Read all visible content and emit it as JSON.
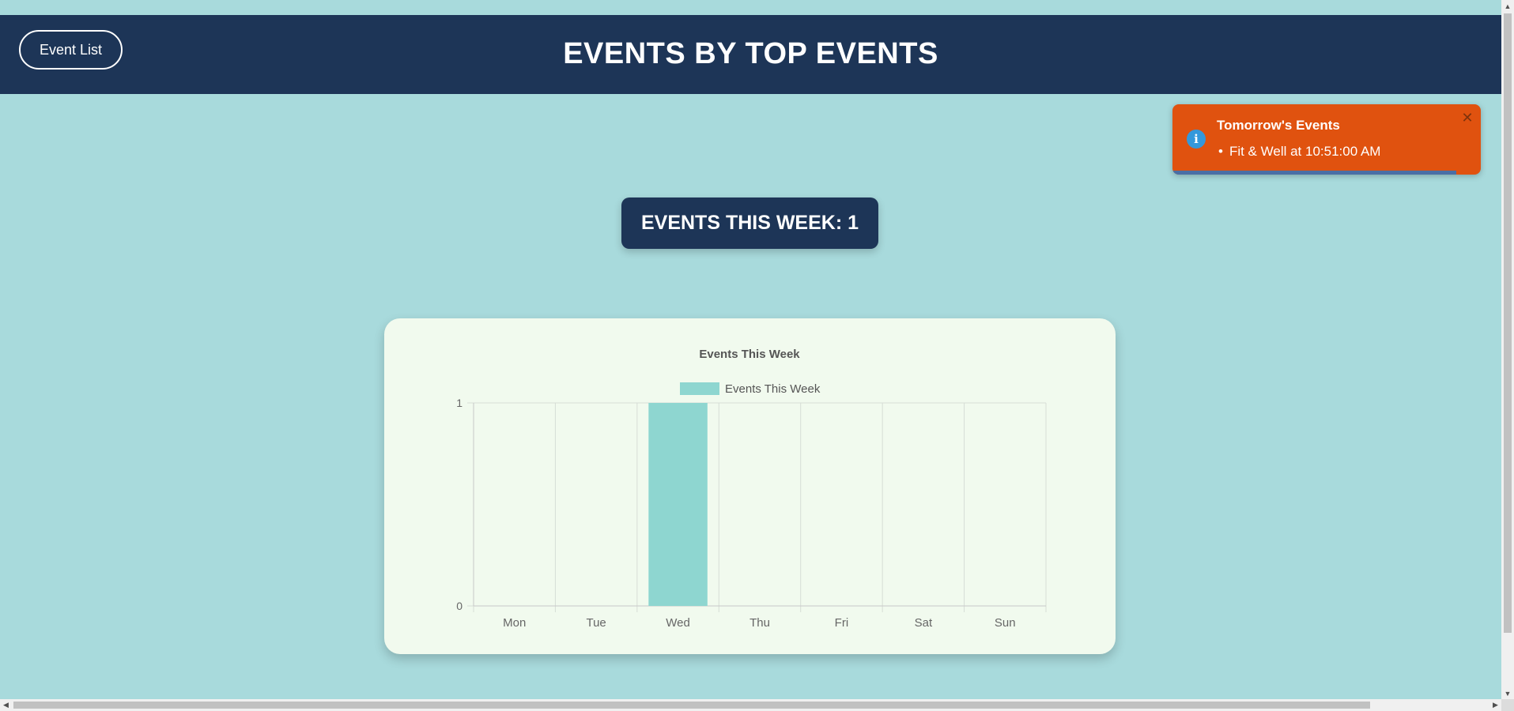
{
  "header": {
    "nav_button_label": "Event List",
    "title": "EVENTS BY TOP EVENTS"
  },
  "toast": {
    "icon": "info-icon",
    "title": "Tomorrow's Events",
    "items": [
      "Fit & Well at 10:51:00 AM"
    ],
    "close_icon": "close-icon",
    "background_color": "#e0520f",
    "progress_fraction": 0.92
  },
  "summary": {
    "label": "EVENTS THIS WEEK: 1"
  },
  "chart_data": {
    "type": "bar",
    "title": "Events This Week",
    "categories": [
      "Mon",
      "Tue",
      "Wed",
      "Thu",
      "Fri",
      "Sat",
      "Sun"
    ],
    "series": [
      {
        "name": "Events This Week",
        "values": [
          0,
          0,
          1,
          0,
          0,
          0,
          0
        ],
        "color": "#8ed6d0"
      }
    ],
    "ylim": [
      0,
      1
    ],
    "yticks": [
      "0",
      "1"
    ],
    "grid": true,
    "legend": "top"
  },
  "colors": {
    "page_background": "#a8dadc",
    "header_background": "#1d3557",
    "card_background": "#f1faee"
  }
}
